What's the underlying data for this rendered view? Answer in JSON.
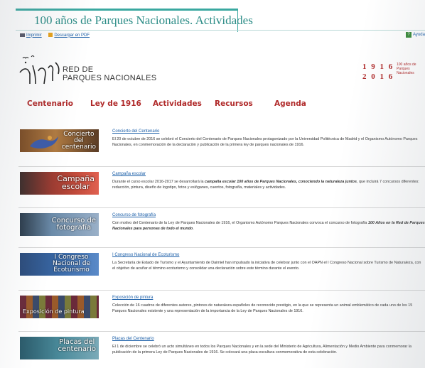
{
  "header": {
    "title": "100 años de Parques Nacionales. Actividades",
    "print_label": "Imprimir",
    "pdf_label": "Descargar en PDF",
    "help_label": "Ayuda"
  },
  "brand": {
    "logo_line1": "RED DE",
    "logo_line2": "PARQUES NACIONALES",
    "year_start": "1 9 1 6",
    "year_end": "2 0 1 6",
    "years_caption_1": "100 años de",
    "years_caption_2": "Parques",
    "years_caption_3": "Nacionales"
  },
  "nav": {
    "items": [
      "Centenario",
      "Ley de 1916",
      "Actividades",
      "Recursos",
      "Agenda"
    ]
  },
  "activities": [
    {
      "thumb_label": "Concierto del centenario",
      "thumb_line1": "Concierto",
      "thumb_line2": "del",
      "thumb_line3": "centenario",
      "title": "Concierto del Centenario",
      "desc": "El 20 de octubre de 2016 se celebró el Concierto del Centenario de Parques Nacionales protagonizado por la Universidad Politécnica de Madrid y el Organismo Autónomo Parques Nacionales, en conmemoración de la declaración y publicación de la primera ley de parques nacionales de 1916."
    },
    {
      "thumb_line1": "Campaña",
      "thumb_line2": "escolar",
      "title": "Campaña escolar",
      "desc_a": "Durante el curso escolar 2016-2017 se desarrollará la ",
      "desc_b": "campaña escolar 100 años de Parques Nacionales, conociendo la naturaleza juntos",
      "desc_c": ", que incluirá 7 concursos diferentes: redacción, pintura, diseño de logotipo, fotos y eslóganes, cuentos, fotografía, materiales y actividades."
    },
    {
      "thumb_line1": "Concurso de",
      "thumb_line2": "fotografía",
      "title": "Concurso de fotografía",
      "desc_a": "Con motivo del Centenario de la Ley de Parques Nacionales de 1916, el Organismo Autónomo Parques Nacionales convoca el concurso de fotografía ",
      "desc_b": "100 Años en la Red de Parques Nacionales para personas de todo el mundo",
      "desc_c": "."
    },
    {
      "thumb_line1": "I Congreso",
      "thumb_line2": "Nacional de",
      "thumb_line3": "Ecoturismo",
      "title": "I Congreso Nacional de Ecoturismo",
      "desc": "La Secretaría de Estado de Turismo y el Ayuntamiento de Daimiel han impulsado la iniciativa de celebrar junto con el OAPN el I Congreso Nacional sobre Turismo de Naturaleza, con el objetivo de acuñar el término ecoturismo y consolidar una declaración sobre este término durante el evento."
    },
    {
      "thumb_line1": "Exposición de pintura",
      "title": "Exposición de pintura",
      "desc": "Colección de 16 cuadros de diferentes autores, pintores de naturaleza españoles de reconocido prestigio, en la que se representa un animal emblemático de cada uno de los 15 Parques Nacionales existente y una representación de la importancia de la Ley de Parques Nacionales de 1916."
    },
    {
      "thumb_line1": "Placas del",
      "thumb_line2": "centenario",
      "title": "Placas del Centenario",
      "desc": "El 1 de diciembre se celebró un acto simultáneo en todos los Parques Nacionales y en la sede del Ministerio de Agricultura, Alimentación y Medio Ambiente para conmemorar la publicación de la primera Ley de Parques Nacionales de 1916. Se colocará una placa-escultura conmemorativa de esta celebración."
    }
  ],
  "colors": {
    "accent_teal": "#2b8c86",
    "nav_red": "#b02a2a",
    "link_blue": "#1a5ea8"
  }
}
